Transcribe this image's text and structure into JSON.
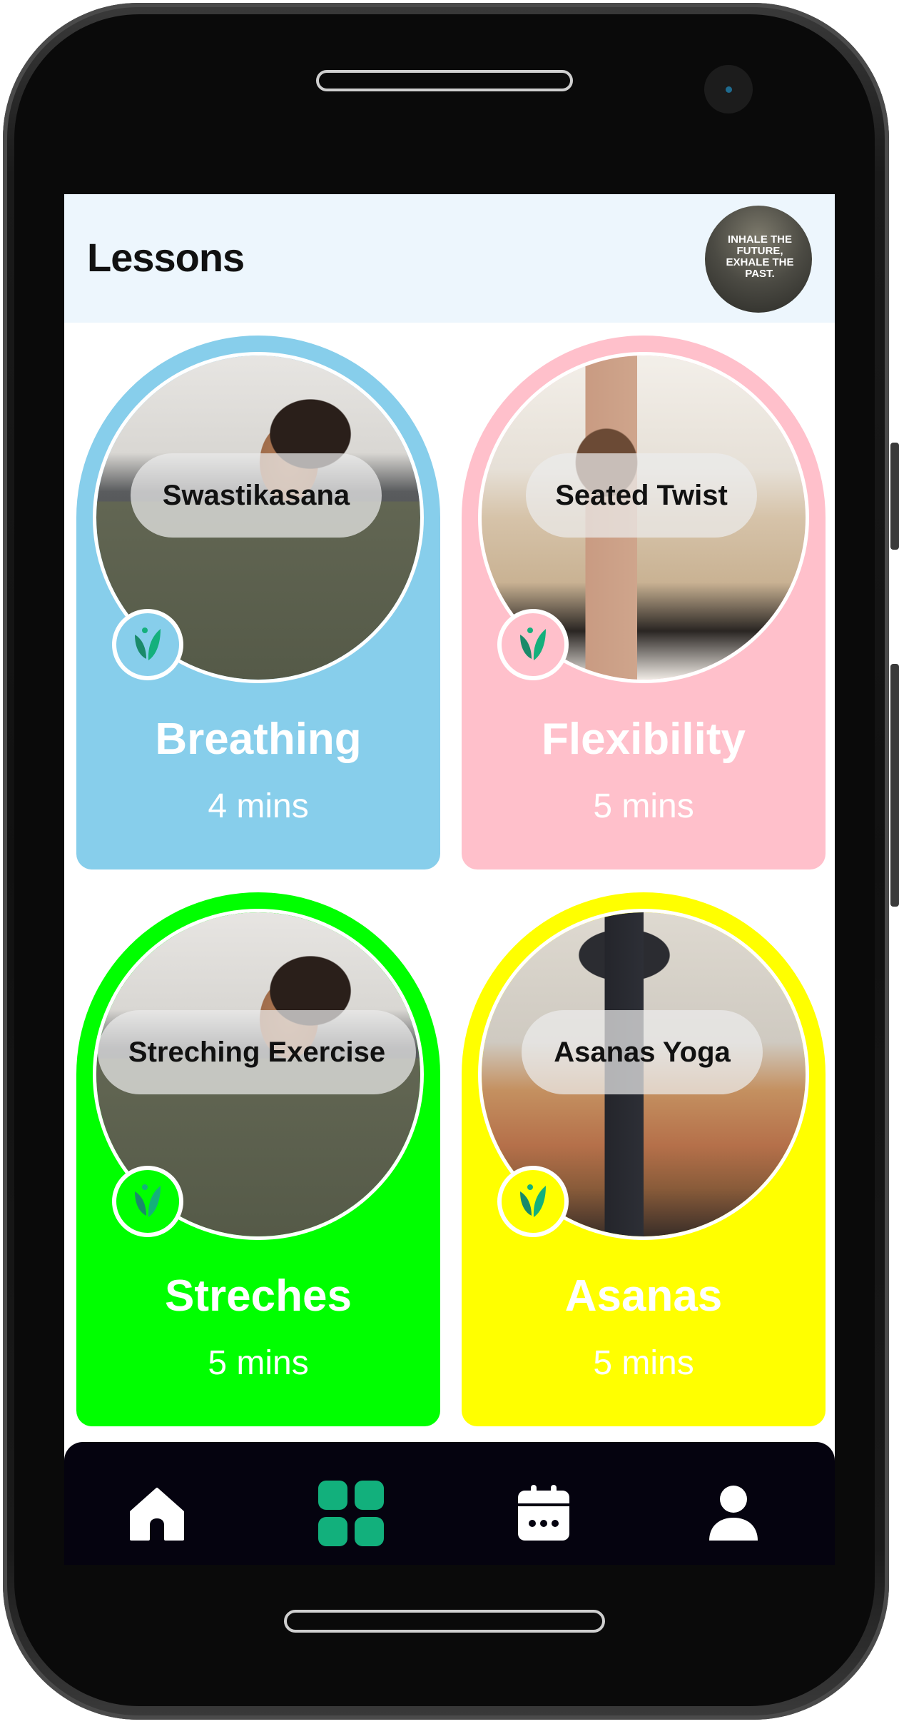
{
  "header": {
    "title": "Lessons",
    "avatar_text": "INHALE THE FUTURE, EXHALE THE PAST."
  },
  "lessons": [
    {
      "pose": "Swastikasana",
      "title": "Breathing",
      "duration": "4 mins",
      "color": "#87ceeb"
    },
    {
      "pose": "Seated Twist",
      "title": "Flexibility",
      "duration": "5 mins",
      "color": "#ffc0cb"
    },
    {
      "pose": "Streching Exercise",
      "title": "Streches",
      "duration": "5 mins",
      "color": "#00ff00"
    },
    {
      "pose": "Asanas Yoga",
      "title": "Asanas",
      "duration": "5 mins",
      "color": "#ffff00"
    }
  ],
  "badge_icon": "leaf-icon",
  "nav": {
    "items": [
      {
        "icon": "home-icon",
        "active": false
      },
      {
        "icon": "grid-icon",
        "active": true
      },
      {
        "icon": "calendar-icon",
        "active": false
      },
      {
        "icon": "user-icon",
        "active": false
      }
    ],
    "active_color": "#12b07c",
    "inactive_color": "#ffffff",
    "background": "#05030f"
  }
}
